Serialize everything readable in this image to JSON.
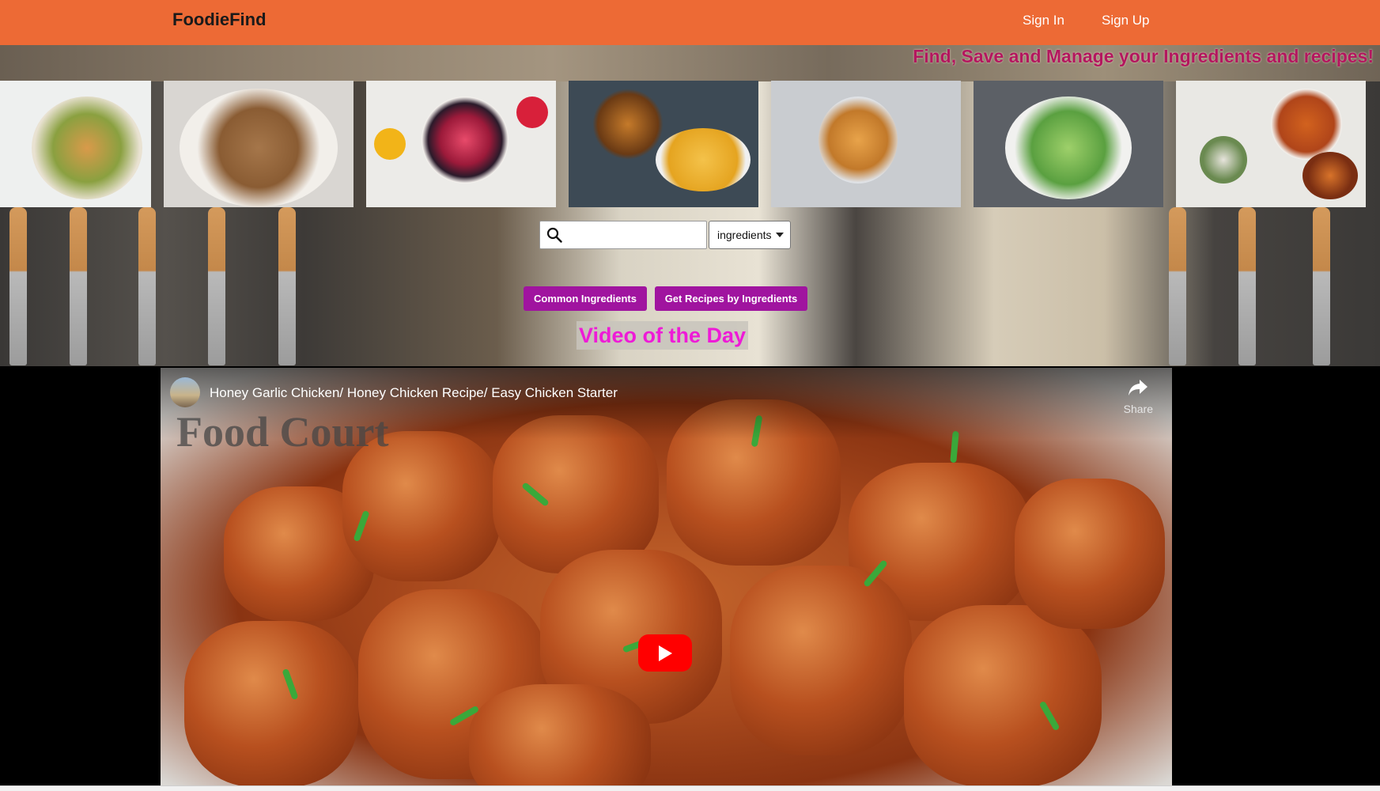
{
  "header": {
    "brand": "FoodieFind",
    "sign_in": "Sign In",
    "sign_up": "Sign Up"
  },
  "hero": {
    "tagline": "Find, Save and Manage your Ingredients and recipes!"
  },
  "search": {
    "placeholder": "",
    "value": "",
    "select_value": "ingredients"
  },
  "buttons": {
    "common": "Common Ingredients",
    "recipes": "Get Recipes by Ingredients"
  },
  "video": {
    "section_title": "Video of the Day",
    "title": "Honey Garlic Chicken/ Honey Chicken Recipe/ Easy Chicken Starter",
    "share_label": "Share"
  },
  "colors": {
    "header_bg": "#ed6a35",
    "tagline": "#b3175f",
    "button_bg": "#a0149f",
    "video_title": "#ee1bd7",
    "play": "#ff0000"
  }
}
